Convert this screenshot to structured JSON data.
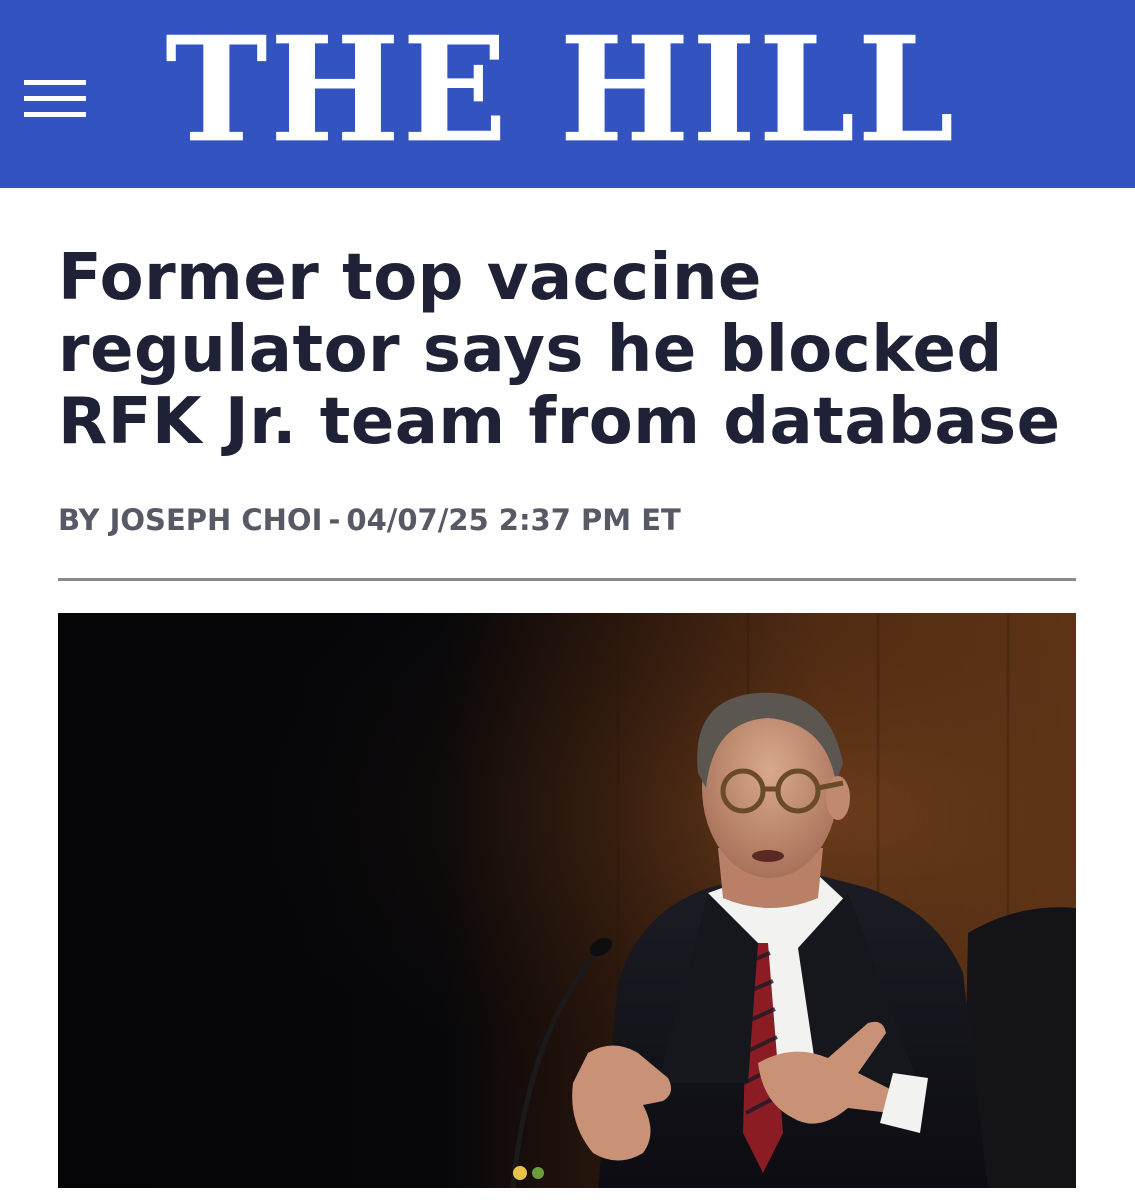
{
  "header": {
    "logo_text": "THE HILL",
    "menu_icon": "hamburger-menu-icon",
    "background_color": "#3253c0"
  },
  "article": {
    "headline": "Former top vaccine regulator says he blocked RFK Jr. team from database",
    "byline": {
      "author": "BY JOSEPH CHOI",
      "separator": "-",
      "timestamp": "04/07/25 2:37 PM ET"
    }
  },
  "colors": {
    "headline": "#1f2236",
    "byline": "#575a66",
    "divider": "#8a8a8a"
  }
}
